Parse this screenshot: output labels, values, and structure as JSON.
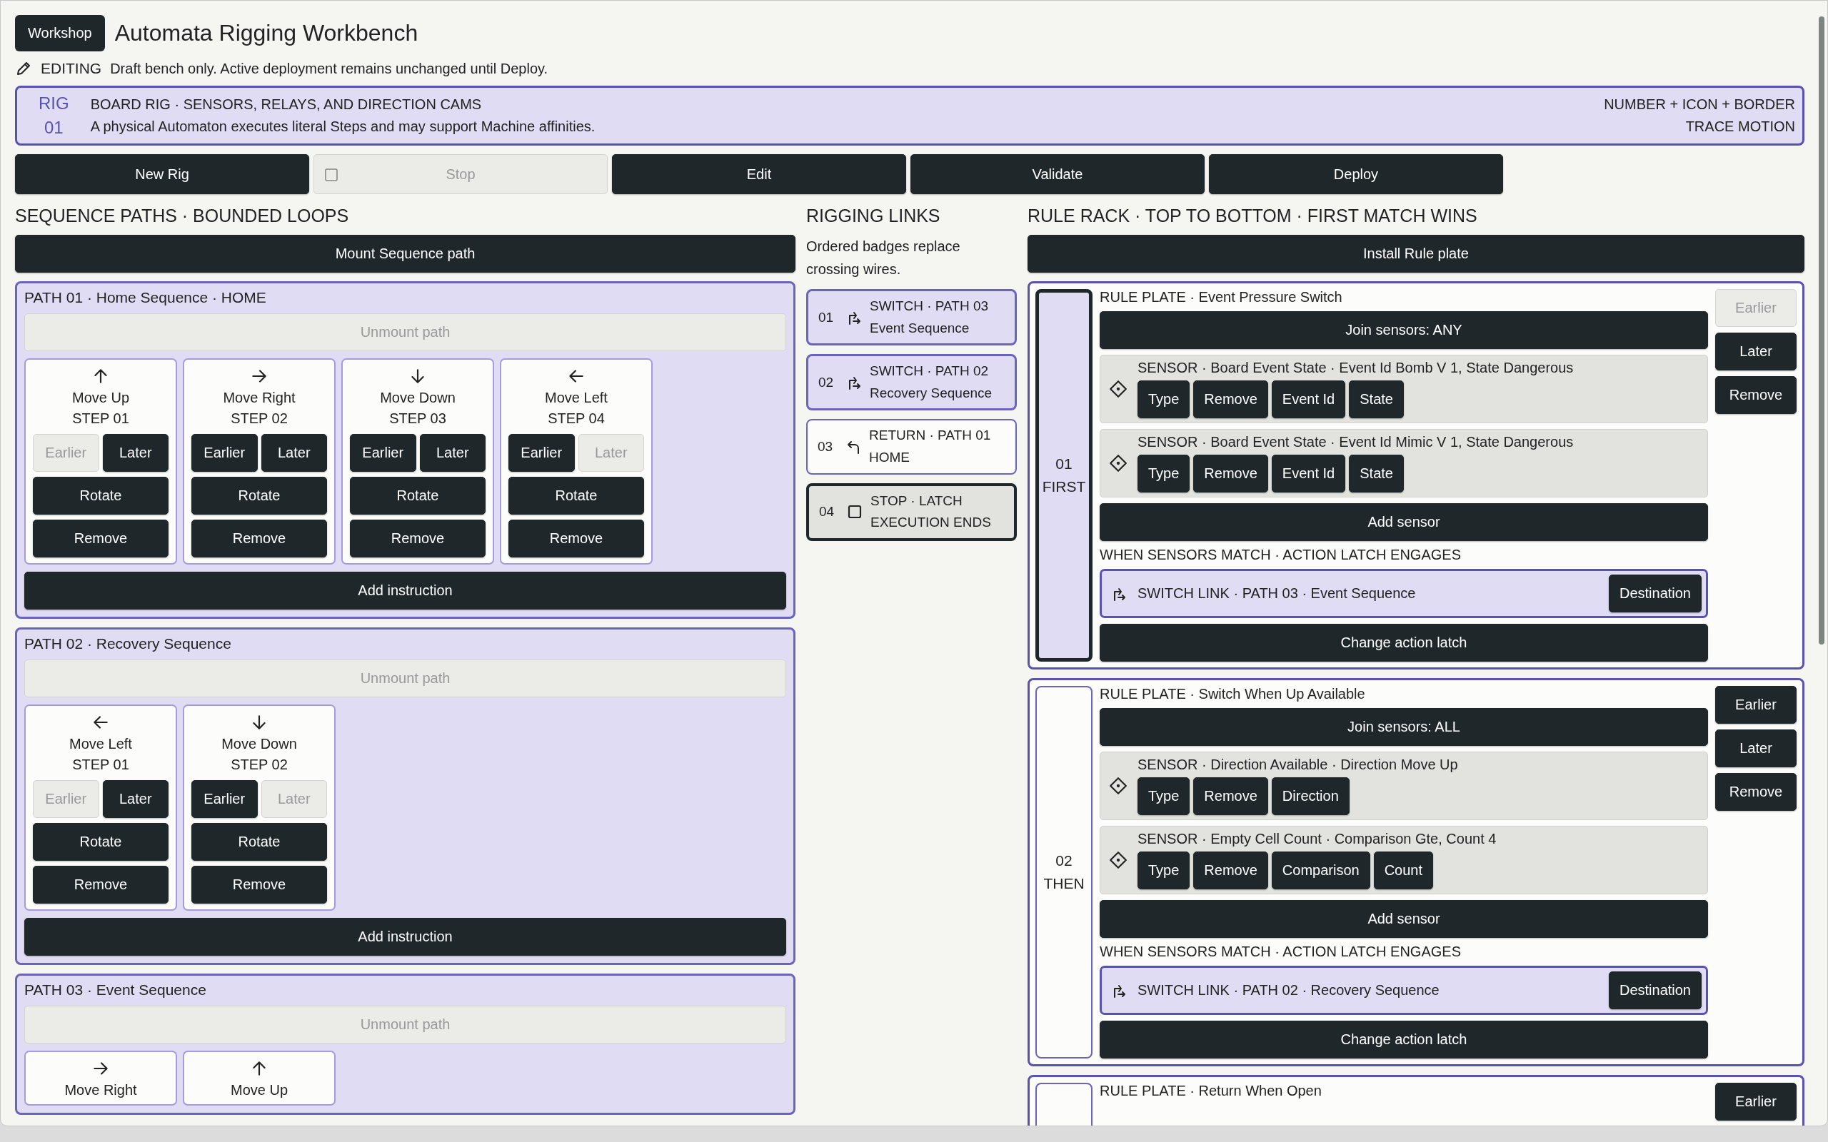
{
  "header": {
    "badge": "Workshop",
    "title": "Automata Rigging Workbench"
  },
  "mode": {
    "label": "EDITING",
    "note": "Draft bench only. Active deployment remains unchanged until Deploy."
  },
  "rig": {
    "label": "RIG",
    "number": "01",
    "title": "BOARD RIG · SENSORS, RELAYS, AND DIRECTION CAMS",
    "description": "A physical Automaton executes literal Steps and may support Machine affinities.",
    "tags": [
      "NUMBER + ICON + BORDER",
      "TRACE MOTION"
    ]
  },
  "actions": [
    {
      "label": "New Rig",
      "kind": "plain",
      "disabled": false
    },
    {
      "label": "Stop",
      "kind": "stop",
      "disabled": true
    },
    {
      "label": "Edit",
      "kind": "plain",
      "disabled": false
    },
    {
      "label": "Validate",
      "kind": "plain",
      "disabled": false
    },
    {
      "label": "Deploy",
      "kind": "plain",
      "disabled": false
    }
  ],
  "sequence": {
    "heading": "SEQUENCE PATHS · BOUNDED LOOPS",
    "mount_button": "Mount Sequence path",
    "paths": [
      {
        "title": "PATH 01 · Home Sequence · HOME",
        "unmount": {
          "label": "Unmount path",
          "disabled": true
        },
        "add_button": "Add instruction",
        "steps": [
          {
            "kind": "up",
            "name": "Move Up",
            "step": "STEP 01",
            "order": [
              {
                "label": "Earlier",
                "disabled": true
              },
              {
                "label": "Later",
                "disabled": false
              }
            ],
            "rotate": "Rotate",
            "remove": "Remove"
          },
          {
            "kind": "right",
            "name": "Move Right",
            "step": "STEP 02",
            "order": [
              {
                "label": "Earlier",
                "disabled": false
              },
              {
                "label": "Later",
                "disabled": false
              }
            ],
            "rotate": "Rotate",
            "remove": "Remove"
          },
          {
            "kind": "down",
            "name": "Move Down",
            "step": "STEP 03",
            "order": [
              {
                "label": "Earlier",
                "disabled": false
              },
              {
                "label": "Later",
                "disabled": false
              }
            ],
            "rotate": "Rotate",
            "remove": "Remove"
          },
          {
            "kind": "left",
            "name": "Move Left",
            "step": "STEP 04",
            "order": [
              {
                "label": "Earlier",
                "disabled": false
              },
              {
                "label": "Later",
                "disabled": true
              }
            ],
            "rotate": "Rotate",
            "remove": "Remove"
          }
        ]
      },
      {
        "title": "PATH 02 · Recovery Sequence",
        "unmount": {
          "label": "Unmount path",
          "disabled": true
        },
        "add_button": "Add instruction",
        "steps": [
          {
            "kind": "left",
            "name": "Move Left",
            "step": "STEP 01",
            "order": [
              {
                "label": "Earlier",
                "disabled": true
              },
              {
                "label": "Later",
                "disabled": false
              }
            ],
            "rotate": "Rotate",
            "remove": "Remove"
          },
          {
            "kind": "down",
            "name": "Move Down",
            "step": "STEP 02",
            "order": [
              {
                "label": "Earlier",
                "disabled": false
              },
              {
                "label": "Later",
                "disabled": true
              }
            ],
            "rotate": "Rotate",
            "remove": "Remove"
          }
        ]
      },
      {
        "title": "PATH 03 · Event Sequence",
        "unmount": {
          "label": "Unmount path",
          "disabled": true
        },
        "steps": [
          {
            "kind": "right",
            "name": "Move Right"
          },
          {
            "kind": "up",
            "name": "Move Up"
          }
        ]
      }
    ]
  },
  "links": {
    "heading": "RIGGING LINKS",
    "note": "Ordered badges replace crossing wires.",
    "items": [
      {
        "number": "01",
        "kind": "switch",
        "title": "SWITCH · PATH 03",
        "target": "Event Sequence"
      },
      {
        "number": "02",
        "kind": "switch",
        "title": "SWITCH · PATH 02",
        "target": "Recovery Sequence"
      },
      {
        "number": "03",
        "kind": "return",
        "title": "RETURN · PATH 01",
        "target": "HOME"
      },
      {
        "number": "04",
        "kind": "stop",
        "title": "STOP · LATCH",
        "target": "EXECUTION ENDS"
      }
    ]
  },
  "rules": {
    "heading": "RULE RACK · TOP TO BOTTOM · FIRST MATCH WINS",
    "install_button": "Install Rule plate",
    "plates": [
      {
        "rank": "01",
        "rank_label": "FIRST",
        "selected": true,
        "title": "RULE PLATE · Event Pressure Switch",
        "join": "Join sensors: ANY",
        "sensors": [
          {
            "text": "SENSOR · Board Event State · Event Id Bomb V 1, State Dangerous",
            "buttons": [
              "Type",
              "Remove",
              "Event Id",
              "State"
            ]
          },
          {
            "text": "SENSOR · Board Event State · Event Id Mimic V 1, State Dangerous",
            "buttons": [
              "Type",
              "Remove",
              "Event Id",
              "State"
            ]
          }
        ],
        "add_sensor": "Add sensor",
        "action_heading": "WHEN SENSORS MATCH · ACTION LATCH ENGAGES",
        "action": {
          "text": "SWITCH LINK · PATH 03 · Event Sequence",
          "button": "Destination"
        },
        "change_button": "Change action latch",
        "side_buttons": [
          {
            "label": "Earlier",
            "disabled": true
          },
          {
            "label": "Later",
            "disabled": false
          },
          {
            "label": "Remove",
            "disabled": false
          }
        ]
      },
      {
        "rank": "02",
        "rank_label": "THEN",
        "selected": false,
        "title": "RULE PLATE · Switch When Up Available",
        "join": "Join sensors: ALL",
        "sensors": [
          {
            "text": "SENSOR · Direction Available · Direction Move Up",
            "buttons": [
              "Type",
              "Remove",
              "Direction"
            ]
          },
          {
            "text": "SENSOR · Empty Cell Count · Comparison Gte, Count 4",
            "buttons": [
              "Type",
              "Remove",
              "Comparison",
              "Count"
            ]
          }
        ],
        "add_sensor": "Add sensor",
        "action_heading": "WHEN SENSORS MATCH · ACTION LATCH ENGAGES",
        "action": {
          "text": "SWITCH LINK · PATH 02 · Recovery Sequence",
          "button": "Destination"
        },
        "change_button": "Change action latch",
        "side_buttons": [
          {
            "label": "Earlier",
            "disabled": false
          },
          {
            "label": "Later",
            "disabled": false
          },
          {
            "label": "Remove",
            "disabled": false
          }
        ]
      },
      {
        "selected": false,
        "title": "RULE PLATE · Return When Open",
        "side_buttons": [
          {
            "label": "Earlier",
            "disabled": false
          }
        ]
      }
    ]
  }
}
